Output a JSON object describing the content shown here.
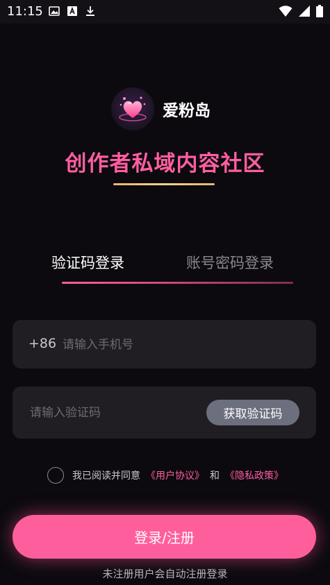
{
  "status": {
    "time": "11:15"
  },
  "brand": {
    "name": "爱粉岛",
    "slogan": "创作者私域内容社区"
  },
  "tabs": [
    {
      "label": "验证码登录",
      "active": true
    },
    {
      "label": "账号密码登录",
      "active": false
    }
  ],
  "phone": {
    "prefix": "+86",
    "placeholder": "请输入手机号"
  },
  "code": {
    "placeholder": "请输入验证码",
    "button": "获取验证码"
  },
  "agreement": {
    "text": "我已阅读并同意",
    "user_agreement": "《用户协议》",
    "and": "和",
    "privacy_policy": "《隐私政策》"
  },
  "login_button": "登录/注册",
  "footer_note": "未注册用户会自动注册登录",
  "colors": {
    "accent": "#ff5e9c",
    "gold": "#f3d488",
    "background": "#0c0a0f"
  }
}
